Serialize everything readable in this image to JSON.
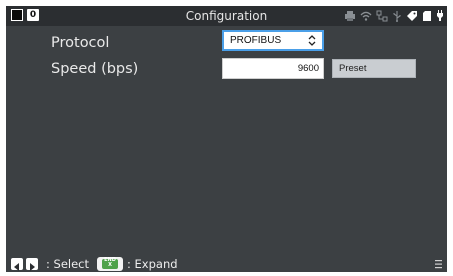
{
  "statusbar": {
    "title": "Configuration",
    "badge": "0",
    "tray_icons": [
      "printer-icon",
      "wifi-icon",
      "network-icon",
      "usb-icon",
      "tag-icon",
      "sd-card-icon",
      "power-plug-icon"
    ]
  },
  "form": {
    "protocol_label": "Protocol",
    "protocol_value": "PROFIBUS",
    "speed_label": "Speed (bps)",
    "speed_value": "9600",
    "preset_label": "Preset"
  },
  "bottombar": {
    "select_hint": ": Select",
    "end_key_top": "END",
    "end_key_bottom": "X",
    "expand_hint": ": Expand"
  },
  "colors": {
    "screen_bg": "#3c4043",
    "statusbar_bg": "#2b2e31",
    "focus_border": "#4a9fe8",
    "end_key_green": "#4fa24a"
  }
}
